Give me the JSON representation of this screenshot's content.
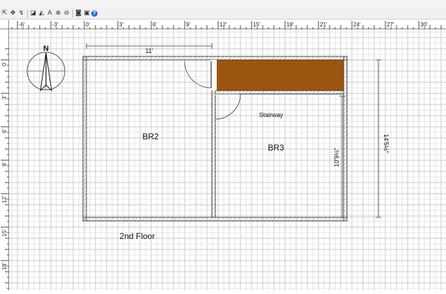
{
  "toolbar": {
    "buttons": [
      {
        "name": "select-arrow-icon",
        "glyph": "⇱"
      },
      {
        "name": "pan-icon",
        "glyph": "✥"
      },
      {
        "name": "create-walls-icon",
        "glyph": "↯"
      },
      {
        "name": "create-rooms-icon",
        "glyph": "◪"
      },
      {
        "name": "create-dimensions-icon",
        "glyph": "◭"
      },
      {
        "name": "add-text-icon",
        "glyph": "A"
      },
      {
        "name": "zoom-in-icon",
        "glyph": "⊕"
      },
      {
        "name": "zoom-out-icon",
        "glyph": "⊖"
      },
      {
        "name": "camera-icon",
        "glyph": "◙"
      },
      {
        "name": "preferences-icon",
        "glyph": "▣"
      },
      {
        "name": "help-icon",
        "glyph": "?"
      }
    ]
  },
  "ruler": {
    "unit": "feet",
    "horizontal_labels": [
      "-6'",
      "-3'",
      "0'",
      "3'",
      "6'",
      "9'",
      "12'",
      "15'",
      "18'",
      "21'",
      "24'",
      "27'",
      "30'"
    ],
    "vertical_labels": [
      "0'",
      "3'",
      "6'",
      "9'",
      "12'",
      "15'",
      "18'"
    ]
  },
  "plan": {
    "level_label": "2nd Floor",
    "rooms": [
      {
        "name": "BR2"
      },
      {
        "name": "BR3"
      },
      {
        "name": "Stairway"
      }
    ],
    "dimensions": {
      "top_width": "11'",
      "right_height": "14'5½\"",
      "inner_height": "10'9½\""
    },
    "stair_color": "#9c5511",
    "wall_color": "#444444",
    "grid_color": "#d4d4d4"
  },
  "compass": {
    "label": "N"
  }
}
